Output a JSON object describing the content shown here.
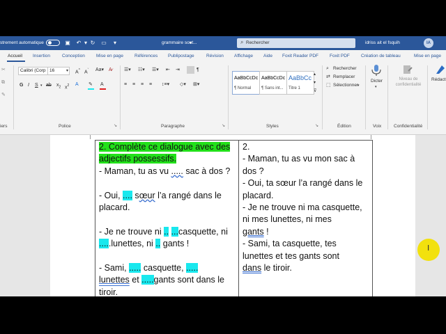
{
  "titlebar": {
    "autosave_label": "Enregistrement automatique",
    "autosave_display": "strement automatique",
    "document_title": "grammaire sout...",
    "search_placeholder": "Rechercher",
    "user_name": "idriss ait el fsquih",
    "user_initials": "IA"
  },
  "tabs": [
    "Accueil",
    "Insertion",
    "Conception",
    "Mise en page",
    "Références",
    "Publipostage",
    "Révision",
    "Affichage",
    "Aide",
    "Foxit Reader PDF",
    "Foxit PDF",
    "Création de tableau",
    "Mise en page"
  ],
  "ribbon": {
    "clipboard_label": "iers",
    "font": {
      "name": "Calibri (Corp",
      "size": "16",
      "group_label": "Police"
    },
    "paragraph": {
      "group_label": "Paragraphe"
    },
    "styles": {
      "items": [
        {
          "sample": "AaBbCcDc",
          "name": "¶ Normal"
        },
        {
          "sample": "AaBbCcDc",
          "name": "¶ Sans int..."
        },
        {
          "sample": "AaBbCc",
          "name": "Titre 1"
        }
      ],
      "group_label": "Styles"
    },
    "editing": {
      "find": "Rechercher",
      "replace": "Remplacer",
      "select": "Sélectionner",
      "group_label": "Édition"
    },
    "voice": {
      "dictate": "Dicter",
      "group_label": "Voix"
    },
    "sensitivity": {
      "label": "Niveau de confidentialité",
      "group_label": "Confidentialité"
    },
    "editor": {
      "label": "Rédacteur"
    }
  },
  "document": {
    "col1": [
      [
        {
          "t": "2. Complète ce dialogue avec des",
          "s": "green"
        }
      ],
      [
        {
          "t": "adjectifs possessifs.",
          "s": "green"
        }
      ],
      [
        {
          "t": "- Maman, tu as vu "
        },
        {
          "t": ".....",
          "s": "sq"
        },
        {
          "t": " sac à dos ?"
        }
      ],
      [],
      [
        {
          "t": "- Oui, "
        },
        {
          "t": "....",
          "s": "cy"
        },
        {
          "t": " s"
        },
        {
          "t": "œur",
          "s": "sq"
        },
        {
          "t": " l’a rangé dans le"
        }
      ],
      [
        {
          "t": "placard."
        }
      ],
      [],
      [
        {
          "t": "- Je ne trouve ni "
        },
        {
          "t": "..",
          "s": "cy"
        },
        {
          "t": " "
        },
        {
          "t": "...",
          "s": "cy"
        },
        {
          "t": "casquette, ni"
        }
      ],
      [
        {
          "t": "....",
          "s": "cy"
        },
        {
          "t": ".lunettes, ni "
        },
        {
          "t": "..",
          "s": "cy"
        },
        {
          "t": " gants !"
        }
      ],
      [],
      [
        {
          "t": "- Sami, "
        },
        {
          "t": ".....",
          "s": "cy"
        },
        {
          "t": " casquette, "
        },
        {
          "t": ".....",
          "s": "cy"
        }
      ],
      [
        {
          "t": "lunettes",
          "s": "dsq"
        },
        {
          "t": " et "
        },
        {
          "t": ".....",
          "s": "cy"
        },
        {
          "t": "gants sont dans le"
        }
      ],
      [
        {
          "t": "tiroir."
        }
      ]
    ],
    "col2": [
      [
        {
          "t": "2."
        }
      ],
      [
        {
          "t": "- Maman, tu as vu mon sac à"
        }
      ],
      [
        {
          "t": "dos ?"
        }
      ],
      [
        {
          "t": "- Oui, ta sœur l’a rangé dans le"
        }
      ],
      [
        {
          "t": "placard."
        }
      ],
      [
        {
          "t": "- Je ne trouve ni ma casquette,"
        }
      ],
      [
        {
          "t": "ni mes lunettes, ni mes"
        }
      ],
      [
        {
          "t": "gants",
          "s": "dsq"
        },
        {
          "t": " !"
        }
      ],
      [
        {
          "t": "- Sami, ta casquette, tes"
        }
      ],
      [
        {
          "t": "lunettes et tes gants sont"
        }
      ],
      [
        {
          "t": "dans",
          "s": "dsq"
        },
        {
          "t": " le tiroir."
        }
      ]
    ]
  },
  "colors": {
    "titlebar": "#2b579a",
    "highlight_green": "#22e01a",
    "highlight_cyan": "#19e8ee",
    "cursor_highlight": "#f2e10e"
  }
}
